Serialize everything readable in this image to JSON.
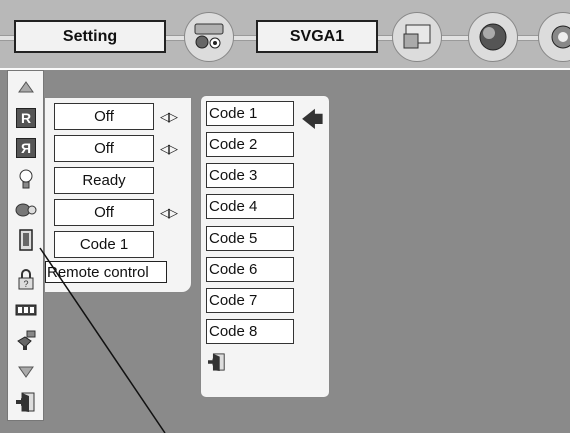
{
  "topbar": {
    "setting_label": "Setting",
    "source_label": "SVGA1"
  },
  "sidebar": {
    "icons": [
      "up-triangle-icon",
      "mirror-flip-icon",
      "reverse-flip-icon",
      "lamp-icon",
      "fan-icon",
      "remote-control-icon",
      "lock-icon",
      "blank-screen-icon",
      "projector-icon",
      "down-triangle-icon",
      "exit-icon"
    ]
  },
  "settings": {
    "row1_value": "Off",
    "row2_value": "Off",
    "row3_value": "Ready",
    "row4_value": "Off",
    "row5_value": "Code 1",
    "arrows": "◁▷",
    "tooltip": "Remote control"
  },
  "codes": {
    "items": [
      "Code 1",
      "Code 2",
      "Code 3",
      "Code 4",
      "Code 5",
      "Code 6",
      "Code 7",
      "Code 8"
    ],
    "selected_marker": "🡄"
  }
}
